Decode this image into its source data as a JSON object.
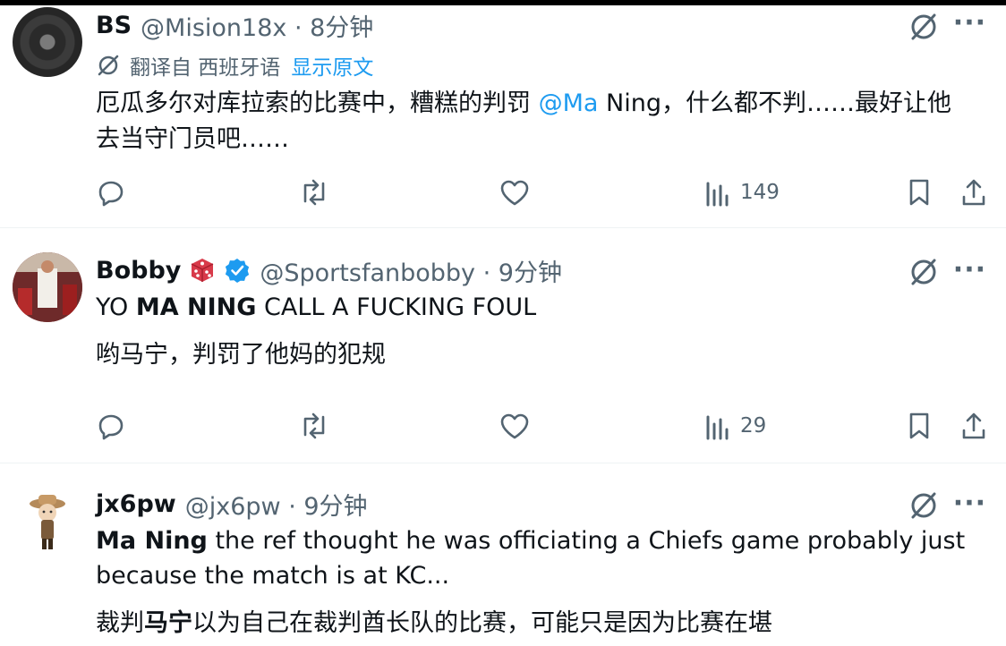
{
  "tweets": [
    {
      "name": "BS",
      "handle": "@Mision18x · 8分钟",
      "translated_from": "翻译自 西班牙语",
      "show_original": "显示原文",
      "text_before_mention": "厄瓜多尔对库拉索的比赛中，糟糕的判罚 ",
      "mention": "@Ma",
      "text_after_mention_line1": " Ning，什么都不判……最好让他",
      "text_line2": "去当守门员吧……",
      "views": "149"
    },
    {
      "name": "Bobby",
      "handle": "@Sportsfanbobby · 9分钟",
      "text_prefix": "YO ",
      "text_bold": "MA NING",
      "text_suffix": " CALL A FUCKING FOUL",
      "translation": "哟马宁，判罚了他妈的犯规",
      "views": "29"
    },
    {
      "name": "jx6pw",
      "handle": "@jx6pw · 9分钟",
      "text_bold": "Ma Ning",
      "text_line1_rest": " the ref thought he was officiating a Chiefs game probably just",
      "text_line2": "because the match is at KC...",
      "translation_prefix": "裁判",
      "translation_bold": "马宁",
      "translation_rest": "以为自己在裁判酋长队的比赛，可能只是因为比赛在堪"
    }
  ],
  "colors": {
    "link": "#1d9bf0",
    "secondary_text": "#536471",
    "verified": "#1d9bf0"
  },
  "icons": [
    "reply-icon",
    "retweet-icon",
    "like-icon",
    "views-icon",
    "bookmark-icon",
    "share-icon",
    "grok-icon",
    "more-icon",
    "translate-icon",
    "verified-badge-icon",
    "dice-icon"
  ]
}
